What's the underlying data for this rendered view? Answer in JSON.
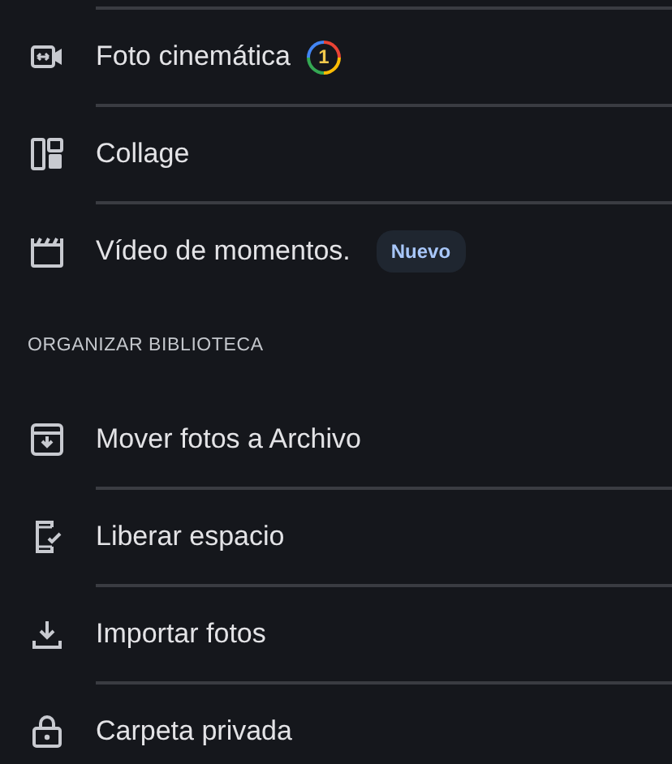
{
  "sections": [
    {
      "items": [
        {
          "label": "Foto cinemática",
          "badge": {
            "kind": "count",
            "text": "1"
          }
        },
        {
          "label": "Collage"
        },
        {
          "label": "Vídeo de momentos.",
          "badge": {
            "kind": "new",
            "text": "Nuevo"
          }
        }
      ]
    },
    {
      "header": "ORGANIZAR BIBLIOTECA",
      "items": [
        {
          "label": "Mover fotos a Archivo"
        },
        {
          "label": "Liberar espacio"
        },
        {
          "label": "Importar fotos"
        },
        {
          "label": "Carpeta privada"
        }
      ]
    }
  ]
}
